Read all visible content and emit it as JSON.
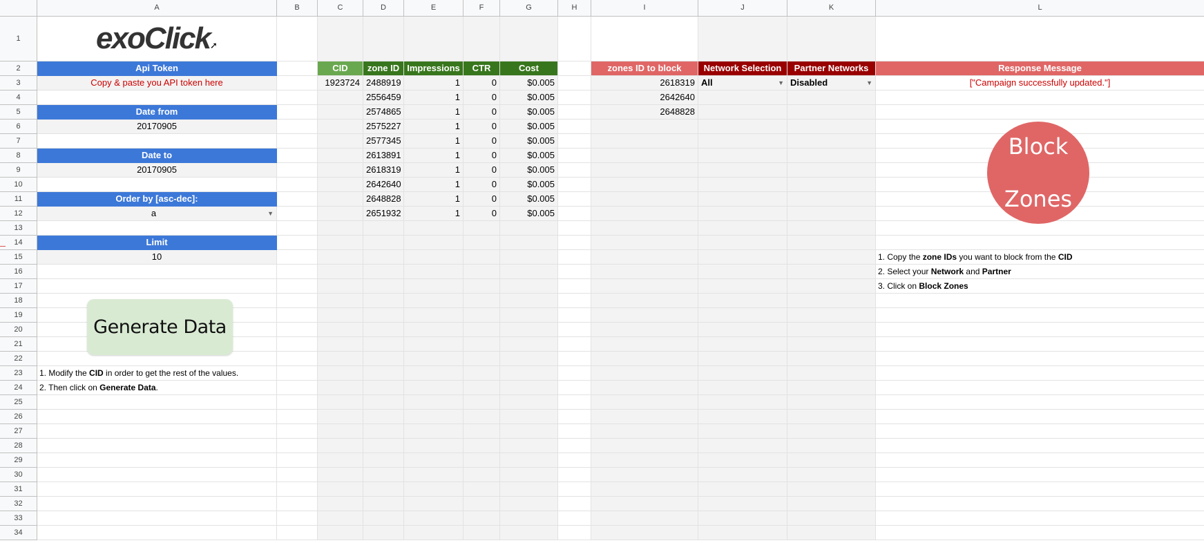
{
  "columns": [
    "",
    "A",
    "B",
    "C",
    "D",
    "E",
    "F",
    "G",
    "H",
    "I",
    "J",
    "K",
    "L"
  ],
  "rows": [
    "1",
    "2",
    "3",
    "4",
    "5",
    "6",
    "7",
    "8",
    "9",
    "10",
    "11",
    "12",
    "13",
    "14",
    "15",
    "16",
    "17",
    "18",
    "19",
    "20",
    "21",
    "22",
    "23",
    "24",
    "25",
    "26",
    "27",
    "28",
    "29",
    "30",
    "31",
    "32",
    "33",
    "34"
  ],
  "logo": {
    "text": "exoClick",
    "icon": "arrow-swoosh-icon"
  },
  "left_panel": {
    "api_token_label": "Api Token",
    "api_token_value": "Copy & paste you API token here",
    "date_from_label": "Date from",
    "date_from_value": "20170905",
    "date_to_label": "Date to",
    "date_to_value": "20170905",
    "order_by_label": "Order by [asc-dec]:",
    "order_by_value": "a",
    "limit_label": "Limit",
    "limit_value": "10",
    "generate_button": "Generate Data",
    "instructions": {
      "line1": {
        "pre": "1. Modify the ",
        "bold": "CID",
        "post": " in order to get the rest of the values."
      },
      "line2": {
        "pre": "2. Then click on ",
        "bold": "Generate Data",
        "post": "."
      }
    }
  },
  "data_table": {
    "headers": [
      "CID",
      "zone ID",
      "Impressions",
      "CTR",
      "Cost"
    ],
    "cid": "1923724",
    "rows": [
      {
        "zone": "2488919",
        "impressions": "1",
        "ctr": "0",
        "cost": "$0.005"
      },
      {
        "zone": "2556459",
        "impressions": "1",
        "ctr": "0",
        "cost": "$0.005"
      },
      {
        "zone": "2574865",
        "impressions": "1",
        "ctr": "0",
        "cost": "$0.005"
      },
      {
        "zone": "2575227",
        "impressions": "1",
        "ctr": "0",
        "cost": "$0.005"
      },
      {
        "zone": "2577345",
        "impressions": "1",
        "ctr": "0",
        "cost": "$0.005"
      },
      {
        "zone": "2613891",
        "impressions": "1",
        "ctr": "0",
        "cost": "$0.005"
      },
      {
        "zone": "2618319",
        "impressions": "1",
        "ctr": "0",
        "cost": "$0.005"
      },
      {
        "zone": "2642640",
        "impressions": "1",
        "ctr": "0",
        "cost": "$0.005"
      },
      {
        "zone": "2648828",
        "impressions": "1",
        "ctr": "0",
        "cost": "$0.005"
      },
      {
        "zone": "2651932",
        "impressions": "1",
        "ctr": "0",
        "cost": "$0.005"
      }
    ]
  },
  "block_panel": {
    "zones_header": "zones ID to block",
    "network_header": "Network Selection",
    "partner_header": "Partner Networks",
    "response_header": "Response Message",
    "zones_to_block": [
      "2618319",
      "2642640",
      "2648828"
    ],
    "network_value": "All",
    "partner_value": "Disabled",
    "response_value": "[\"Campaign successfully updated.\"]",
    "block_button_line1": "Block",
    "block_button_line2": "Zones",
    "instructions": {
      "line1": {
        "pre": "1. Copy the ",
        "bold": "zone IDs",
        "mid": " you want to block from the ",
        "bold2": "CID"
      },
      "line2": {
        "pre": "2. Select your ",
        "bold": "Network",
        "mid": " and ",
        "bold2": "Partner"
      },
      "line3": {
        "pre": "3. Click on ",
        "bold": "Block Zones"
      }
    }
  },
  "colors": {
    "header_blue": "#3c78d8",
    "header_light_green": "#6aa84f",
    "header_dark_green": "#38761d",
    "header_salmon": "#e06666",
    "header_dark_red": "#990000",
    "generate_button_bg": "#d9ead3",
    "block_button_bg": "#e06666"
  }
}
